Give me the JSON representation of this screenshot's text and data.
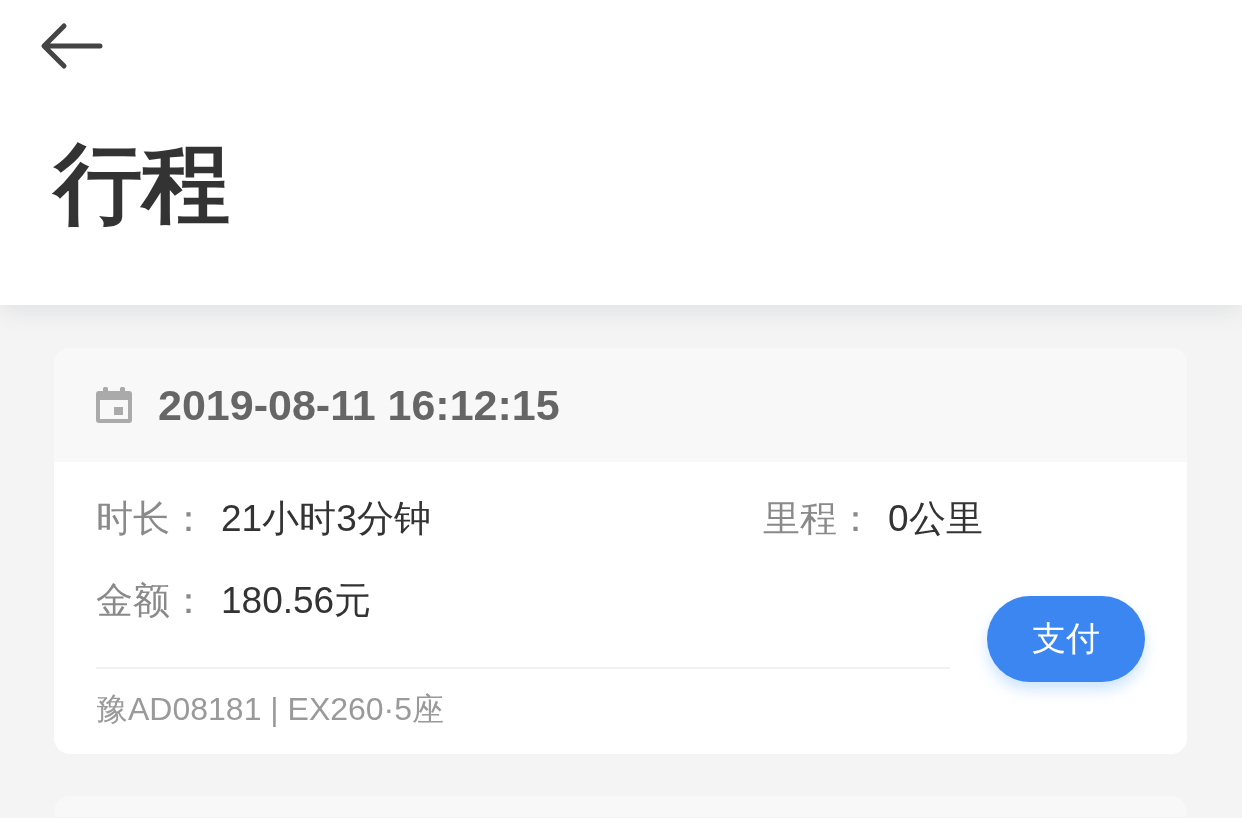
{
  "header": {
    "title": "行程"
  },
  "trips": [
    {
      "date": "2019-08-11 16:12:15",
      "fields": [
        {
          "label": "时长：",
          "value": "21小时3分钟"
        },
        {
          "label": "里程：",
          "value": "0公里"
        },
        {
          "label": "金额：",
          "value": "180.56元"
        }
      ],
      "vehicle": "豫AD08181 | EX260·5座",
      "action": "支付"
    }
  ]
}
